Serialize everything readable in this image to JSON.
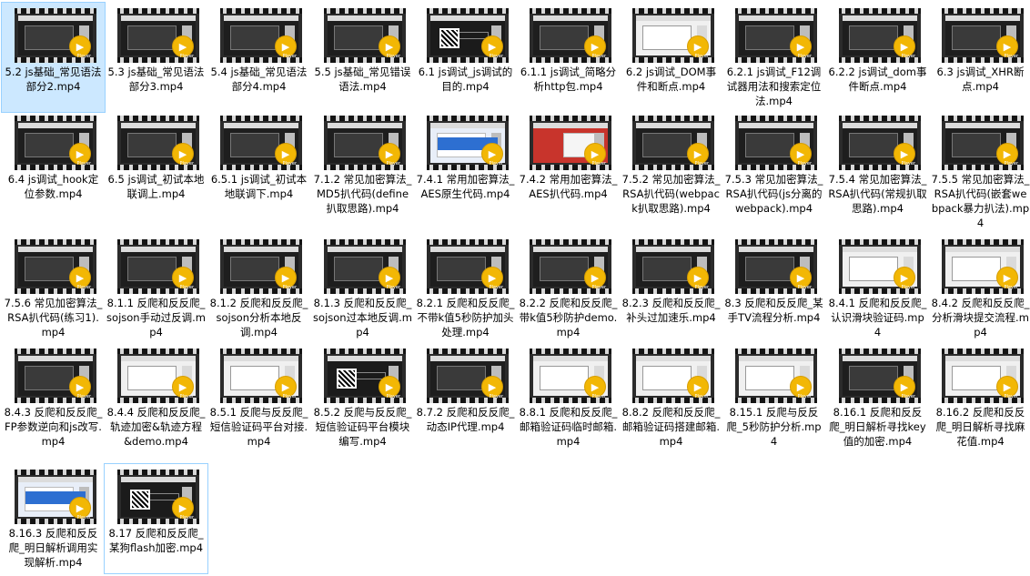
{
  "player_badge_text": "Player",
  "items": [
    {
      "label": "5.2 js基础_常见语法部分2.mp4",
      "thumb": "v-dark",
      "selected": true
    },
    {
      "label": "5.3 js基础_常见语法部分3.mp4",
      "thumb": "v-dark"
    },
    {
      "label": "5.4 js基础_常见语法部分4.mp4",
      "thumb": "v-dark"
    },
    {
      "label": "5.5 js基础_常见错误语法.mp4",
      "thumb": "v-dark"
    },
    {
      "label": "6.1 js调试_js调试的目的.mp4",
      "thumb": "v-logo"
    },
    {
      "label": "6.1.1 js调试_简略分析http包.mp4",
      "thumb": "v-dark"
    },
    {
      "label": "6.2 js调试_DOM事件和断点.mp4",
      "thumb": "v-light"
    },
    {
      "label": "6.2.1 js调试_F12调试器用法和搜索定位法.mp4",
      "thumb": "v-dark"
    },
    {
      "label": "6.2.2 js调试_dom事件断点.mp4",
      "thumb": "v-dark"
    },
    {
      "label": "6.3 js调试_XHR断点.mp4",
      "thumb": "v-dark"
    },
    {
      "label": "6.4 js调试_hook定位参数.mp4",
      "thumb": "v-dark"
    },
    {
      "label": "6.5 js调试_初试本地联调上.mp4",
      "thumb": "v-dark"
    },
    {
      "label": "6.5.1 js调试_初试本地联调下.mp4",
      "thumb": "v-dark"
    },
    {
      "label": "7.1.2 常见加密算法_MD5扒代码(define扒取思路).mp4",
      "thumb": "v-dark"
    },
    {
      "label": "7.4.1 常用加密算法_AES原生代码.mp4",
      "thumb": "v-blue"
    },
    {
      "label": "7.4.2 常用加密算法_AES扒代码.mp4",
      "thumb": "v-red"
    },
    {
      "label": "7.5.2 常见加密算法_RSA扒代码(webpack扒取思路).mp4",
      "thumb": "v-dark"
    },
    {
      "label": "7.5.3 常见加密算法_RSA扒代码(js分离的webpack).mp4",
      "thumb": "v-dark"
    },
    {
      "label": "7.5.4 常见加密算法_RSA扒代码(常规扒取思路).mp4",
      "thumb": "v-dark"
    },
    {
      "label": "7.5.5 常见加密算法_RSA扒代码(嵌套webpack暴力扒法).mp4",
      "thumb": "v-dark"
    },
    {
      "label": "7.5.6 常见加密算法_RSA扒代码(练习1).mp4",
      "thumb": "v-dark"
    },
    {
      "label": "8.1.1 反爬和反反爬_sojson手动过反调.mp4",
      "thumb": "v-dark"
    },
    {
      "label": "8.1.2 反爬和反反爬_sojson分析本地反调.mp4",
      "thumb": "v-dark"
    },
    {
      "label": "8.1.3 反爬和反反爬_sojson过本地反调.mp4",
      "thumb": "v-dark"
    },
    {
      "label": "8.2.1 反爬和反反爬_不带k值5秒防护加头处理.mp4",
      "thumb": "v-dark"
    },
    {
      "label": "8.2.2 反爬和反反爬_带k值5秒防护demo.mp4",
      "thumb": "v-dark"
    },
    {
      "label": "8.2.3 反爬和反反爬_补头过加速乐.mp4",
      "thumb": "v-dark"
    },
    {
      "label": "8.3 反爬和反反爬_某手TV流程分析.mp4",
      "thumb": "v-dark"
    },
    {
      "label": "8.4.1 反爬和反反爬_认识滑块验证码.mp4",
      "thumb": "v-light"
    },
    {
      "label": "8.4.2 反爬和反反爬_分析滑块提交流程.mp4",
      "thumb": "v-light"
    },
    {
      "label": "8.4.3 反爬和反反爬_FP参数逆向和js改写.mp4",
      "thumb": "v-dark"
    },
    {
      "label": "8.4.4 反爬和反反爬_轨迹加密&轨迹方程&demo.mp4",
      "thumb": "v-light"
    },
    {
      "label": "8.5.1 反爬与反反爬_短信验证码平台对接.mp4",
      "thumb": "v-light"
    },
    {
      "label": "8.5.2 反爬与反反爬_短信验证码平台模块编写.mp4",
      "thumb": "v-logo"
    },
    {
      "label": "8.7.2 反爬和反反爬_动态IP代理.mp4",
      "thumb": "v-dark"
    },
    {
      "label": "8.8.1 反爬和反反爬_邮箱验证码临时邮箱.mp4",
      "thumb": "v-light"
    },
    {
      "label": "8.8.2 反爬和反反爬_邮箱验证码搭建邮箱.mp4",
      "thumb": "v-light"
    },
    {
      "label": "8.15.1 反爬与反反爬_5秒防护分析.mp4",
      "thumb": "v-light"
    },
    {
      "label": "8.16.1 反爬和反反爬_明日解析寻找key值的加密.mp4",
      "thumb": "v-dark"
    },
    {
      "label": "8.16.2 反爬和反反爬_明日解析寻找麻花值.mp4",
      "thumb": "v-light"
    },
    {
      "label": "8.16.3 反爬和反反爬_明日解析调用实现解析.mp4",
      "thumb": "v-blue"
    },
    {
      "label": "8.17 反爬和反反爬_某狗flash加密.mp4",
      "thumb": "v-logo",
      "selected2": true
    }
  ]
}
